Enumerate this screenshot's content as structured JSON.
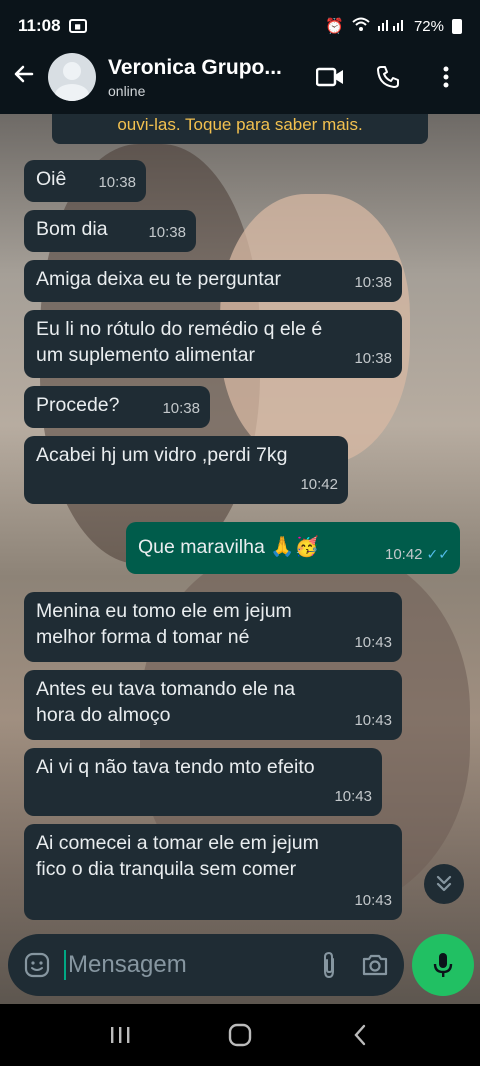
{
  "status_bar": {
    "time": "11:08",
    "battery": "72%",
    "notification_icon": "notification-icon"
  },
  "header": {
    "contact_name": "Veronica Grupo...",
    "status": "online",
    "icons": [
      "back-arrow-icon",
      "video-call-icon",
      "voice-call-icon",
      "more-options-icon"
    ]
  },
  "banner": {
    "text": "ouvi-las. Toque para saber mais."
  },
  "messages": [
    {
      "direction": "in",
      "text": "Oiê",
      "time": "10:38"
    },
    {
      "direction": "in",
      "text": "Bom dia",
      "time": "10:38"
    },
    {
      "direction": "in",
      "text": "Amiga deixa eu te perguntar",
      "time": "10:38"
    },
    {
      "direction": "in",
      "text": "Eu li no rótulo do remédio q ele é",
      "text2": "um suplemento alimentar",
      "time": "10:38"
    },
    {
      "direction": "in",
      "text": "Procede?",
      "time": "10:38"
    },
    {
      "direction": "in",
      "text": "Acabei hj um vidro ,perdi 7kg",
      "time": "10:42"
    },
    {
      "direction": "out",
      "text": "Que maravilha 🙏🥳",
      "time": "10:42",
      "read": true
    },
    {
      "direction": "in",
      "text": "Menina eu tomo ele em jejum",
      "text2": "melhor forma d tomar né",
      "time": "10:43"
    },
    {
      "direction": "in",
      "text": "Antes eu tava tomando ele na",
      "text2": "hora do almoço",
      "time": "10:43"
    },
    {
      "direction": "in",
      "text": "Ai vi q não tava tendo mto efeito",
      "time": "10:43"
    },
    {
      "direction": "in",
      "text": "Ai comecei a tomar ele em jejum",
      "text2": "fico o dia tranquila sem comer",
      "time": "10:43"
    }
  ],
  "composer": {
    "placeholder": "Mensagem",
    "icons": [
      "sticker-icon",
      "attach-icon",
      "camera-icon",
      "mic-icon"
    ]
  },
  "colors": {
    "incoming_bubble": "#1f2c34",
    "outgoing_bubble": "#005c4b",
    "accent": "#21c063",
    "read_ticks": "#53bdeb",
    "banner_text": "#f2c04f"
  }
}
